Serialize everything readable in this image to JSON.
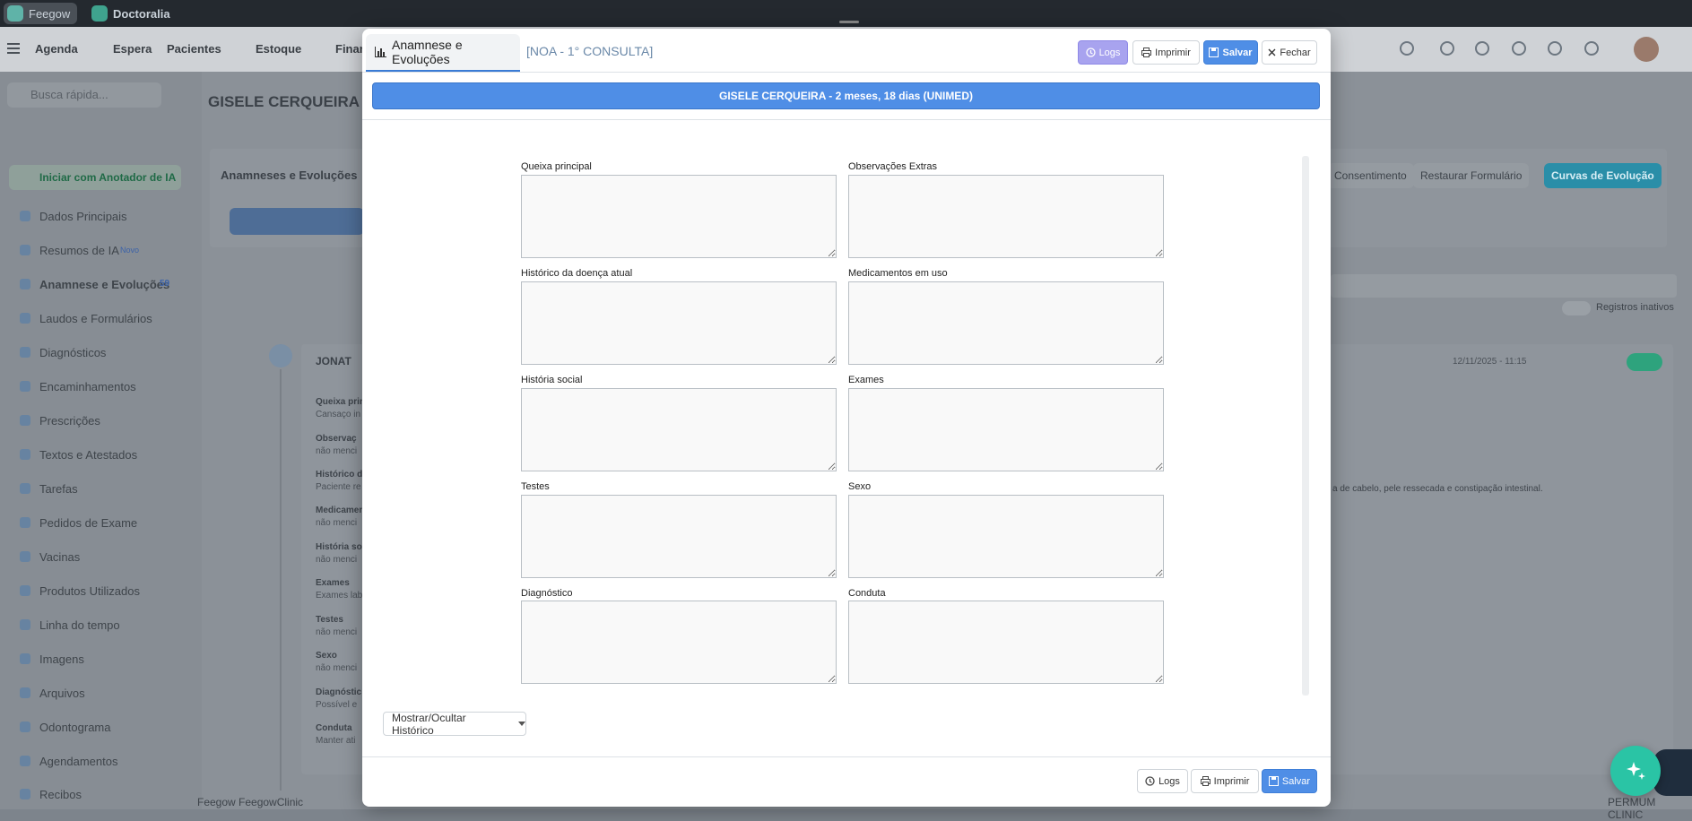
{
  "top_apps": [
    {
      "label": "Feegow"
    },
    {
      "label": "Doctoralia"
    }
  ],
  "nav": {
    "items": [
      "Agenda",
      "Espera",
      "Pacientes",
      "Estoque",
      "Finan"
    ]
  },
  "background": {
    "search_placeholder": "Busca rápida...",
    "patient_breadcrumb": "GISELE CERQUEIRA",
    "ia_button": "Iniciar com Anotador de IA",
    "card_title": "Anamneses e Evoluções",
    "sidebar": [
      "Dados Principais",
      "Resumos de IA",
      "Anamnese e Evoluções",
      "Laudos e Formulários",
      "Diagnósticos",
      "Encaminhamentos",
      "Prescrições",
      "Textos e Atestados",
      "Tarefas",
      "Pedidos de Exame",
      "Vacinas",
      "Produtos Utilizados",
      "Linha do tempo",
      "Imagens",
      "Arquivos",
      "Odontograma",
      "Agendamentos",
      "Recibos"
    ],
    "new_badge": "Novo",
    "count_badge": "59",
    "btn_consent": "Consentimento",
    "btn_restore": "Restaurar Formulário",
    "btn_curves": "Curvas de Evolução",
    "toggle_label": "Registros inativos",
    "record_title": "JONAT",
    "record_date": "12/11/2025 - 11:15",
    "record_fields": [
      {
        "label": "Queixa prin",
        "value": "Cansaço in"
      },
      {
        "label": "Observaç",
        "value": "não menci"
      },
      {
        "label": "Histórico d",
        "value": "Paciente re"
      },
      {
        "label": "Medicamen",
        "value": "não menci"
      },
      {
        "label": "História so",
        "value": "não menci"
      },
      {
        "label": "Exames",
        "value": "Exames lab"
      },
      {
        "label": "Testes",
        "value": "não menci"
      },
      {
        "label": "Sexo",
        "value": "não menci"
      },
      {
        "label": "Diagnóstic",
        "value": "Possível e"
      },
      {
        "label": "Conduta",
        "value": "Manter ati"
      }
    ],
    "record_text_tail": "a de cabelo, pele ressecada e constipação intestinal.",
    "footer_left": "Feegow FeegowClinic",
    "footer_right": "PERMUM CLINIC"
  },
  "modal": {
    "tab_active": "Anamnese e Evoluções",
    "tab_secondary": "[NOA - 1° CONSULTA]",
    "buttons": {
      "logs": "Logs",
      "print": "Imprimir",
      "save": "Salvar",
      "close": "Fechar"
    },
    "banner": "GISELE CERQUEIRA -  2 meses, 18 dias (UNIMED)",
    "fields_left": [
      "Queixa principal",
      "Histórico da doença atual",
      "História social",
      "Testes",
      "Diagnóstico"
    ],
    "fields_right": [
      "Observações Extras",
      "Medicamentos em uso",
      "Exames",
      "Sexo",
      "Conduta"
    ],
    "dropdown": "Mostrar/Ocultar Histórico",
    "footer_buttons": {
      "logs": "Logs",
      "print": "Imprimir",
      "save": "Salvar"
    }
  },
  "icons": [
    "menu-icon",
    "phone-icon",
    "mail-icon",
    "grid-icon",
    "bell-icon",
    "chat-icon",
    "help-icon",
    "chart-icon",
    "history-icon",
    "printer-icon",
    "save-icon",
    "close-icon",
    "sparkle-icon"
  ],
  "colors": {
    "primary": "#4f8ee6",
    "logs": "#a8a3ef",
    "fab": "#2ac4a5",
    "topbar": "#24292f"
  }
}
